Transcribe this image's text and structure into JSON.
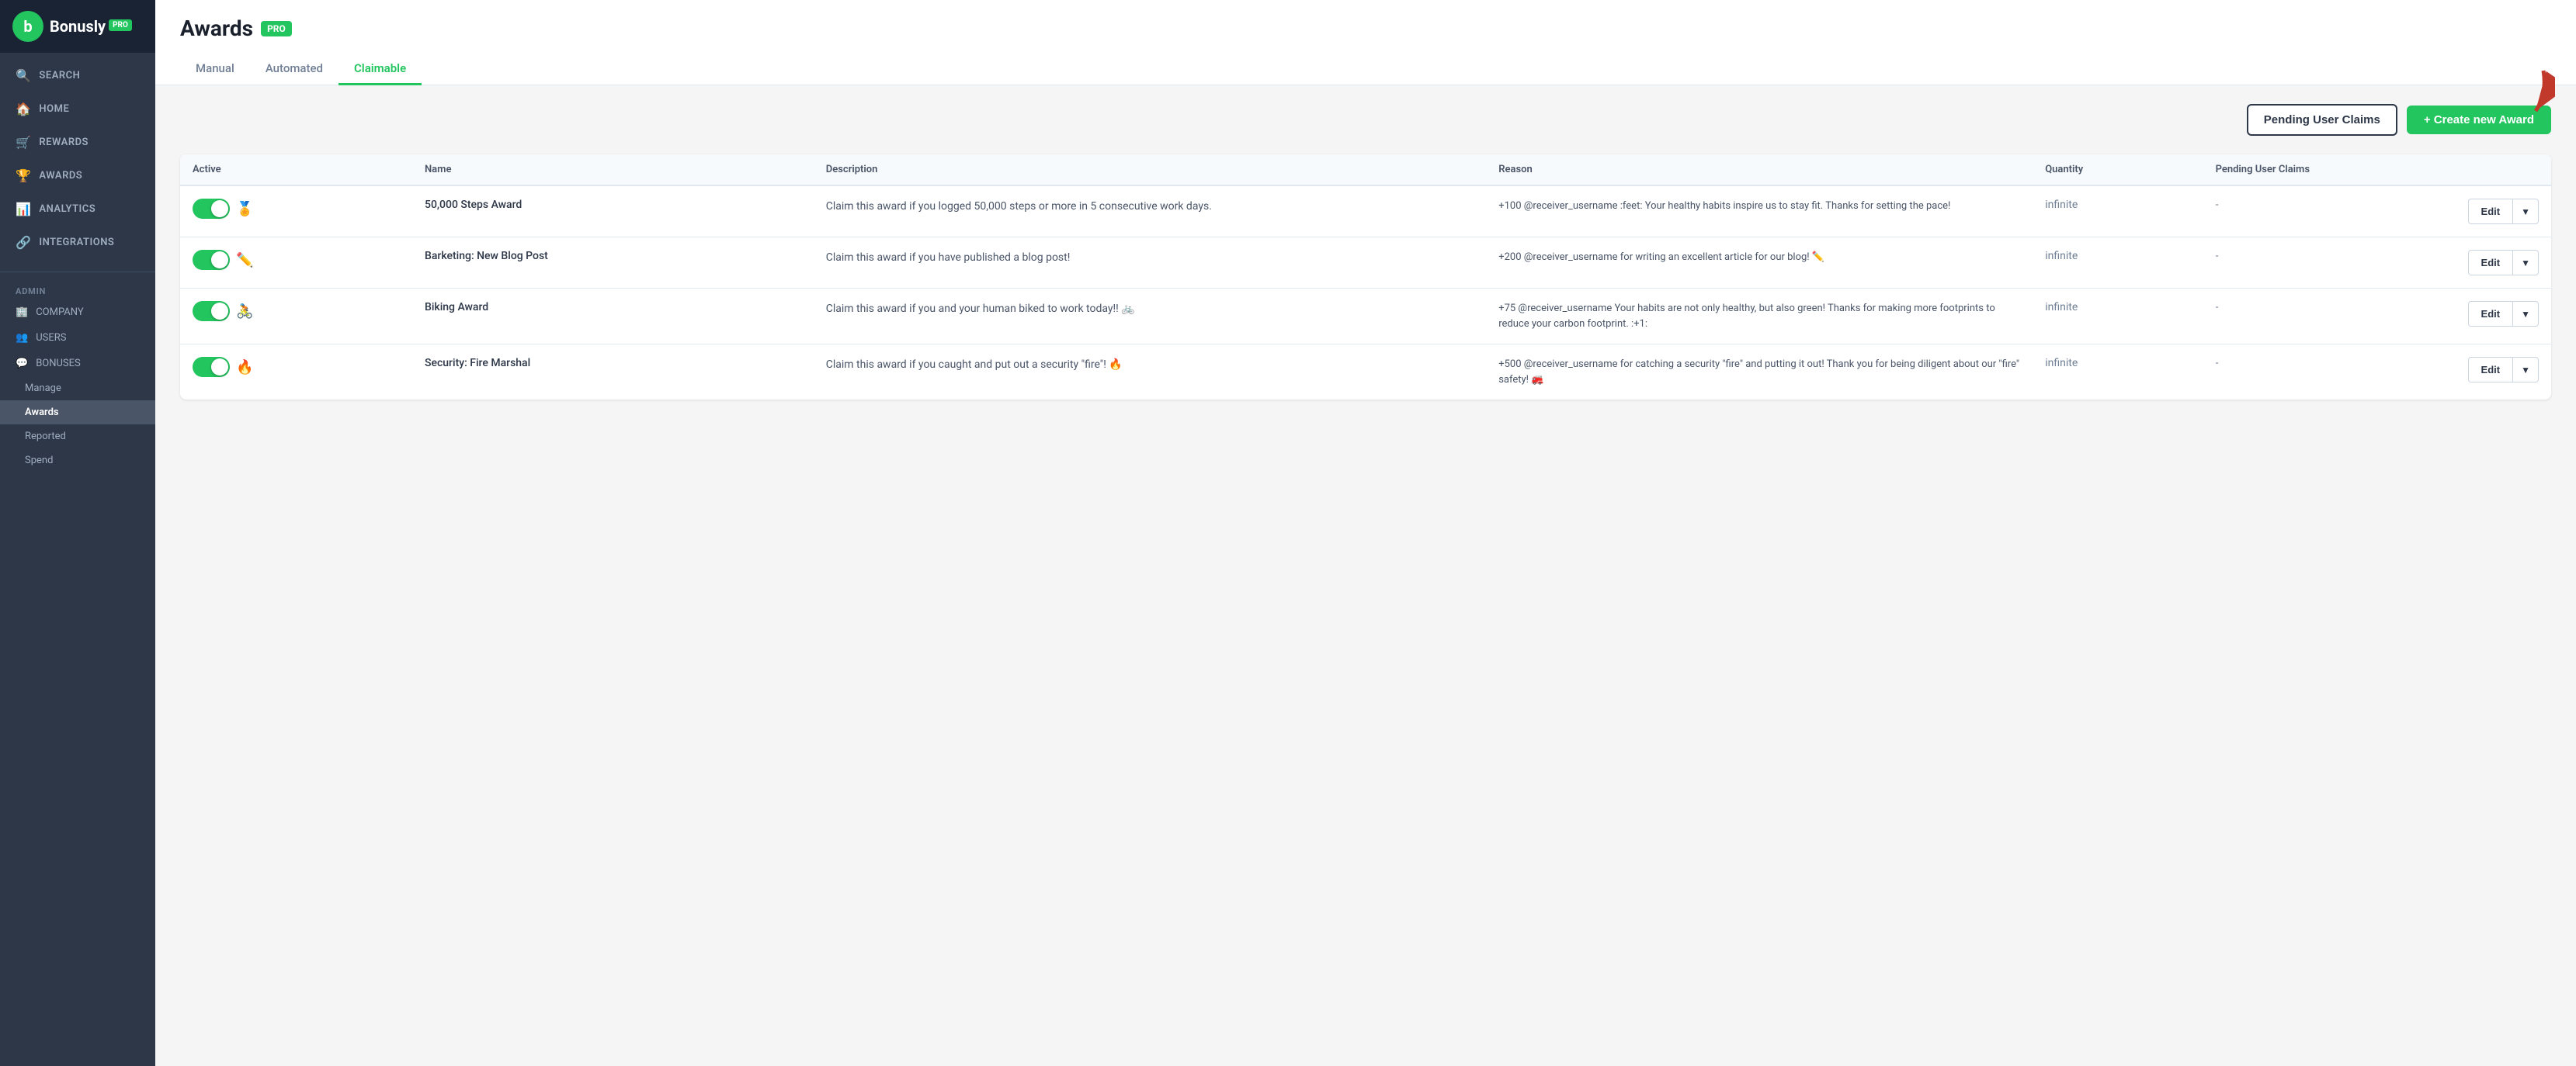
{
  "sidebar": {
    "logo": {
      "text": "Bonusly",
      "pro_badge": "PRO",
      "icon_letter": "b"
    },
    "nav_items": [
      {
        "id": "search",
        "label": "SEARCH",
        "icon": "🔍"
      },
      {
        "id": "home",
        "label": "HOME",
        "icon": "🏠"
      },
      {
        "id": "rewards",
        "label": "REWARDS",
        "icon": "🛒"
      },
      {
        "id": "awards",
        "label": "AWARDS",
        "icon": "🏆"
      },
      {
        "id": "analytics",
        "label": "ANALYTICS",
        "icon": "📊"
      },
      {
        "id": "integrations",
        "label": "INTEGRATIONS",
        "icon": "🔗"
      }
    ],
    "admin_label": "ADMIN",
    "admin_items": [
      {
        "id": "company",
        "label": "COMPANY",
        "icon": "🏢"
      },
      {
        "id": "users",
        "label": "USERS",
        "icon": "👥"
      },
      {
        "id": "bonuses",
        "label": "BONUSES",
        "icon": "💬"
      }
    ],
    "manage_label": "Manage",
    "manage_items": [
      {
        "id": "awards-sub",
        "label": "Awards",
        "active": true
      },
      {
        "id": "reported",
        "label": "Reported"
      },
      {
        "id": "spend",
        "label": "Spend"
      }
    ]
  },
  "header": {
    "title": "Awards",
    "pro_badge": "PRO"
  },
  "tabs": [
    {
      "id": "manual",
      "label": "Manual",
      "active": false
    },
    {
      "id": "automated",
      "label": "Automated",
      "active": false
    },
    {
      "id": "claimable",
      "label": "Claimable",
      "active": true
    }
  ],
  "actions": {
    "pending_claims_label": "Pending User Claims",
    "create_award_label": "+ Create new Award"
  },
  "table": {
    "columns": [
      {
        "id": "active",
        "label": "Active"
      },
      {
        "id": "name",
        "label": "Name"
      },
      {
        "id": "description",
        "label": "Description"
      },
      {
        "id": "reason",
        "label": "Reason"
      },
      {
        "id": "quantity",
        "label": "Quantity"
      },
      {
        "id": "pending_claims",
        "label": "Pending User Claims"
      }
    ],
    "rows": [
      {
        "id": 1,
        "active": true,
        "icon": "50K+⚙️",
        "icon_emoji": "🏅",
        "name": "50,000 Steps Award",
        "description": "Claim this award if you logged 50,000 steps or more in 5 consecutive work days.",
        "reason": "+100 @receiver_username :feet: Your healthy habits inspire us to stay fit. Thanks for setting the pace!",
        "quantity": "infinite",
        "pending_claims": "-"
      },
      {
        "id": 2,
        "active": true,
        "icon": "📝",
        "icon_emoji": "✏️",
        "name": "Barketing: New Blog Post",
        "description": "Claim this award if you have published a blog post!",
        "reason": "+200 @receiver_username for writing an excellent article for our blog! ✏️",
        "quantity": "infinite",
        "pending_claims": "-"
      },
      {
        "id": 3,
        "active": true,
        "icon": "🚲",
        "icon_emoji": "🚴",
        "name": "Biking Award",
        "description": "Claim this award if you and your human biked to work today!! 🚲",
        "reason": "+75 @receiver_username Your habits are not only healthy, but also green! Thanks for making more footprints to reduce your carbon footprint. :+1:",
        "quantity": "infinite",
        "pending_claims": "-"
      },
      {
        "id": 4,
        "active": true,
        "icon": "🔥",
        "icon_emoji": "🚒",
        "name": "Security: Fire Marshal",
        "description": "Claim this award if you caught and put out a security \"fire\"! 🔥",
        "reason": "+500 @receiver_username for catching a security \"fire\" and putting it out! Thank you for being diligent about our \"fire\" safety! 🚒",
        "quantity": "infinite",
        "pending_claims": "-"
      }
    ]
  }
}
